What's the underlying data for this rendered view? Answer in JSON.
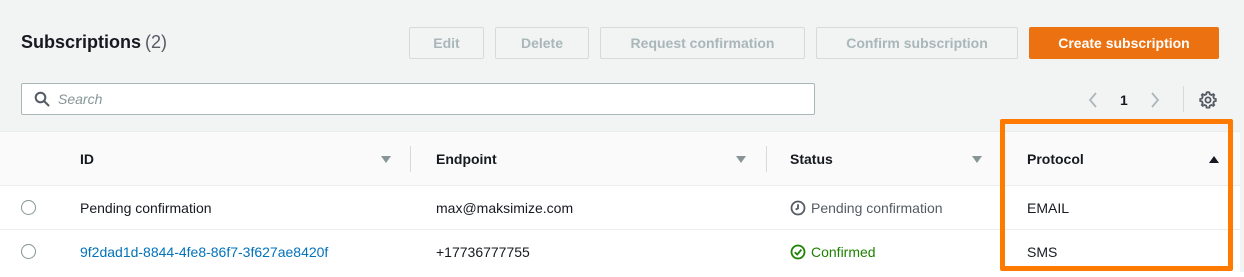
{
  "header": {
    "title": "Subscriptions",
    "count": "(2)"
  },
  "toolbar": {
    "edit_label": "Edit",
    "delete_label": "Delete",
    "request_confirmation_label": "Request confirmation",
    "confirm_subscription_label": "Confirm subscription",
    "create_subscription_label": "Create subscription"
  },
  "search": {
    "placeholder": "Search",
    "value": ""
  },
  "pagination": {
    "current_page": "1"
  },
  "table": {
    "columns": [
      {
        "label": "ID",
        "sort": "unsorted"
      },
      {
        "label": "Endpoint",
        "sort": "unsorted"
      },
      {
        "label": "Status",
        "sort": "unsorted"
      },
      {
        "label": "Protocol",
        "sort": "ascending"
      }
    ],
    "rows": [
      {
        "id": "Pending confirmation",
        "id_is_link": false,
        "endpoint": "max@maksimize.com",
        "status": "Pending confirmation",
        "status_icon": "clock-icon",
        "protocol": "EMAIL"
      },
      {
        "id": "9f2dad1d-8844-4fe8-86f7-3f627ae8420f",
        "id_is_link": true,
        "endpoint": "+17736777755",
        "status": "Confirmed",
        "status_icon": "check-circle-icon",
        "protocol": "SMS"
      }
    ]
  },
  "colors": {
    "primary_button": "#ec7211",
    "link": "#0073bb",
    "success": "#1d8102",
    "highlight": "#ff7a00"
  }
}
